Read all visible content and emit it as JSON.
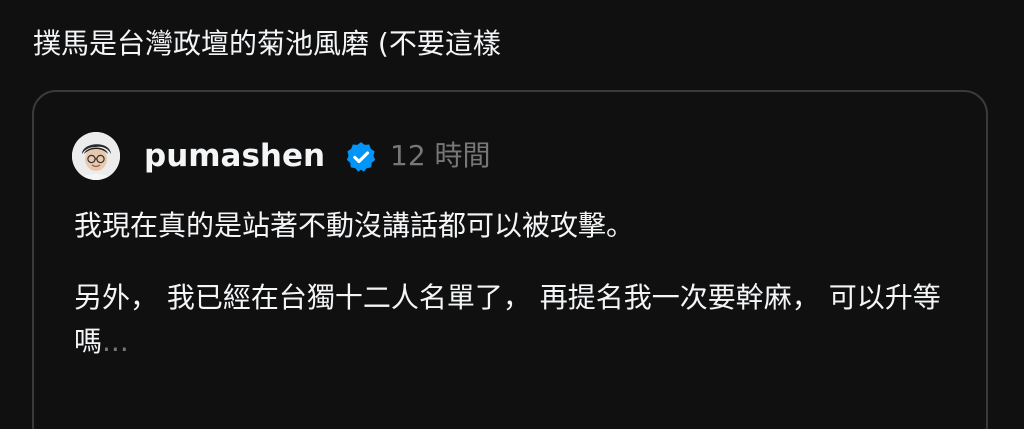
{
  "post": {
    "text": "撲馬是台灣政壇的菊池風磨 (不要這樣"
  },
  "quoted_post": {
    "username": "pumashen",
    "verified": true,
    "timestamp": "12 時間",
    "paragraph_1": "我現在真的是站著不動沒講話都可以被攻擊。",
    "paragraph_2": "另外， 我已經在台獨十二人名單了， 再提名我一次要幹麻， 可以升等嗎",
    "ellipsis": "..."
  },
  "icons": {
    "verified": "verified-badge-icon",
    "avatar": "avatar-image"
  },
  "colors": {
    "background": "#101010",
    "text_primary": "#f3f5f7",
    "text_secondary": "#777777",
    "verified_blue": "#0095f6",
    "card_border": "#3a3a3a"
  }
}
